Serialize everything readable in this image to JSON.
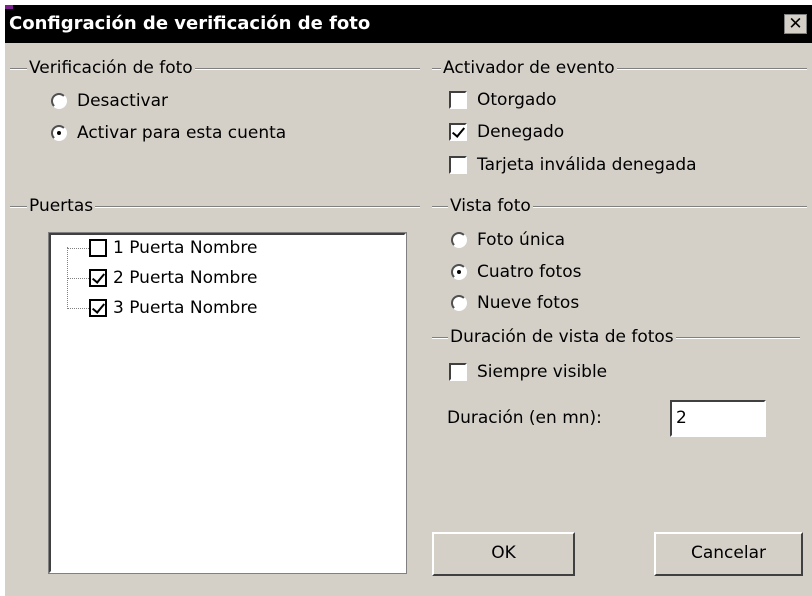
{
  "window": {
    "title": "Configración de verificación de foto",
    "close_glyph": "✕"
  },
  "photo_verification": {
    "legend": "Verificación de foto",
    "options": [
      {
        "label": "Desactivar",
        "selected": false
      },
      {
        "label": "Activar para esta cuenta",
        "selected": true
      }
    ]
  },
  "event_trigger": {
    "legend": "Activador de evento",
    "options": [
      {
        "label": "Otorgado",
        "checked": false
      },
      {
        "label": "Denegado",
        "checked": true
      },
      {
        "label": "Tarjeta inválida denegada",
        "checked": false
      }
    ]
  },
  "doors": {
    "legend": "Puertas",
    "items": [
      {
        "label": "1 Puerta Nombre",
        "checked": false
      },
      {
        "label": "2 Puerta Nombre",
        "checked": true
      },
      {
        "label": "3 Puerta Nombre",
        "checked": true
      }
    ]
  },
  "photo_view": {
    "legend": "Vista foto",
    "options": [
      {
        "label": "Foto única",
        "selected": false
      },
      {
        "label": "Cuatro fotos",
        "selected": true
      },
      {
        "label": "Nueve fotos",
        "selected": false
      }
    ]
  },
  "view_duration": {
    "legend": "Duración de vista de fotos",
    "always_visible_label": "Siempre visible",
    "always_visible_checked": false,
    "duration_label": "Duración (en mn):",
    "duration_value": "2"
  },
  "buttons": {
    "ok": "OK",
    "cancel": "Cancelar"
  },
  "colors": {
    "title_bar": "#000000",
    "dialog_face": "#d4d0c8",
    "accent": "#7a1f8c"
  }
}
